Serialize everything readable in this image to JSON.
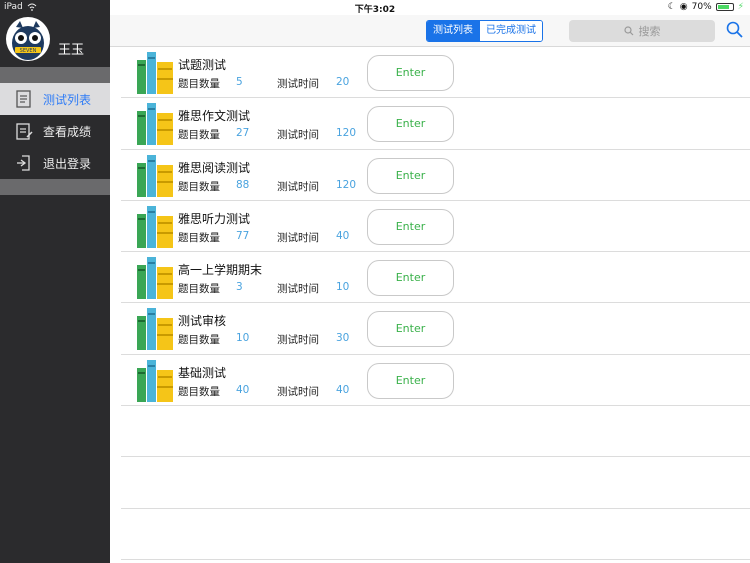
{
  "status_bar": {
    "device": "iPad",
    "time": "下午3:02",
    "battery": "70%"
  },
  "sidebar": {
    "username": "王玉",
    "avatar_badge": "SEVEN",
    "items": [
      {
        "label": "测试列表",
        "active": true
      },
      {
        "label": "查看成绩",
        "active": false
      },
      {
        "label": "退出登录",
        "active": false
      }
    ]
  },
  "topnav": {
    "segments": [
      "测试列表",
      "已完成测试"
    ],
    "search_placeholder": "搜索"
  },
  "list": {
    "count_label": "题目数量",
    "time_label": "测试时间",
    "button_label": "Enter",
    "items": [
      {
        "title": "试题测试",
        "count": "5",
        "time": "20"
      },
      {
        "title": "雅思作文测试",
        "count": "27",
        "time": "120"
      },
      {
        "title": "雅思阅读测试",
        "count": "88",
        "time": "120"
      },
      {
        "title": "雅思听力测试",
        "count": "77",
        "time": "40"
      },
      {
        "title": "高一上学期期末",
        "count": "3",
        "time": "10"
      },
      {
        "title": "测试审核",
        "count": "10",
        "time": "30"
      },
      {
        "title": "基础测试",
        "count": "40",
        "time": "40"
      }
    ]
  },
  "colors": {
    "accent": "#1a73e8",
    "enter_text": "#3ab14a",
    "value_text": "#4aa3df",
    "sidebar_bg": "#2b2b2d"
  }
}
